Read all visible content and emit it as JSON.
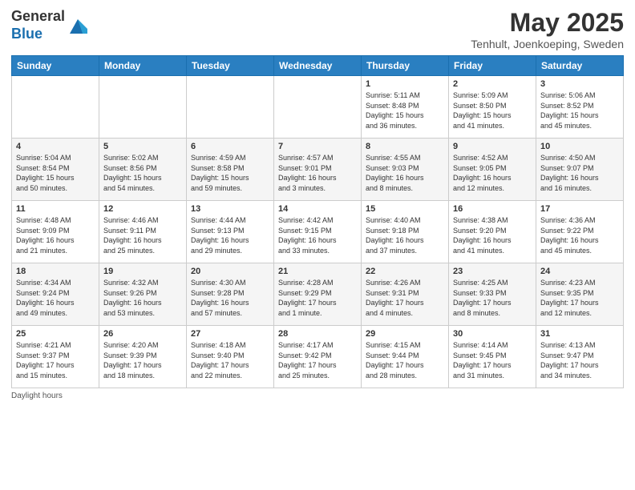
{
  "logo": {
    "line1": "General",
    "line2": "Blue"
  },
  "title": "May 2025",
  "subtitle": "Tenhult, Joenkoeping, Sweden",
  "footer": "Daylight hours",
  "weekdays": [
    "Sunday",
    "Monday",
    "Tuesday",
    "Wednesday",
    "Thursday",
    "Friday",
    "Saturday"
  ],
  "weeks": [
    [
      {
        "num": "",
        "info": ""
      },
      {
        "num": "",
        "info": ""
      },
      {
        "num": "",
        "info": ""
      },
      {
        "num": "",
        "info": ""
      },
      {
        "num": "1",
        "info": "Sunrise: 5:11 AM\nSunset: 8:48 PM\nDaylight: 15 hours\nand 36 minutes."
      },
      {
        "num": "2",
        "info": "Sunrise: 5:09 AM\nSunset: 8:50 PM\nDaylight: 15 hours\nand 41 minutes."
      },
      {
        "num": "3",
        "info": "Sunrise: 5:06 AM\nSunset: 8:52 PM\nDaylight: 15 hours\nand 45 minutes."
      }
    ],
    [
      {
        "num": "4",
        "info": "Sunrise: 5:04 AM\nSunset: 8:54 PM\nDaylight: 15 hours\nand 50 minutes."
      },
      {
        "num": "5",
        "info": "Sunrise: 5:02 AM\nSunset: 8:56 PM\nDaylight: 15 hours\nand 54 minutes."
      },
      {
        "num": "6",
        "info": "Sunrise: 4:59 AM\nSunset: 8:58 PM\nDaylight: 15 hours\nand 59 minutes."
      },
      {
        "num": "7",
        "info": "Sunrise: 4:57 AM\nSunset: 9:01 PM\nDaylight: 16 hours\nand 3 minutes."
      },
      {
        "num": "8",
        "info": "Sunrise: 4:55 AM\nSunset: 9:03 PM\nDaylight: 16 hours\nand 8 minutes."
      },
      {
        "num": "9",
        "info": "Sunrise: 4:52 AM\nSunset: 9:05 PM\nDaylight: 16 hours\nand 12 minutes."
      },
      {
        "num": "10",
        "info": "Sunrise: 4:50 AM\nSunset: 9:07 PM\nDaylight: 16 hours\nand 16 minutes."
      }
    ],
    [
      {
        "num": "11",
        "info": "Sunrise: 4:48 AM\nSunset: 9:09 PM\nDaylight: 16 hours\nand 21 minutes."
      },
      {
        "num": "12",
        "info": "Sunrise: 4:46 AM\nSunset: 9:11 PM\nDaylight: 16 hours\nand 25 minutes."
      },
      {
        "num": "13",
        "info": "Sunrise: 4:44 AM\nSunset: 9:13 PM\nDaylight: 16 hours\nand 29 minutes."
      },
      {
        "num": "14",
        "info": "Sunrise: 4:42 AM\nSunset: 9:15 PM\nDaylight: 16 hours\nand 33 minutes."
      },
      {
        "num": "15",
        "info": "Sunrise: 4:40 AM\nSunset: 9:18 PM\nDaylight: 16 hours\nand 37 minutes."
      },
      {
        "num": "16",
        "info": "Sunrise: 4:38 AM\nSunset: 9:20 PM\nDaylight: 16 hours\nand 41 minutes."
      },
      {
        "num": "17",
        "info": "Sunrise: 4:36 AM\nSunset: 9:22 PM\nDaylight: 16 hours\nand 45 minutes."
      }
    ],
    [
      {
        "num": "18",
        "info": "Sunrise: 4:34 AM\nSunset: 9:24 PM\nDaylight: 16 hours\nand 49 minutes."
      },
      {
        "num": "19",
        "info": "Sunrise: 4:32 AM\nSunset: 9:26 PM\nDaylight: 16 hours\nand 53 minutes."
      },
      {
        "num": "20",
        "info": "Sunrise: 4:30 AM\nSunset: 9:28 PM\nDaylight: 16 hours\nand 57 minutes."
      },
      {
        "num": "21",
        "info": "Sunrise: 4:28 AM\nSunset: 9:29 PM\nDaylight: 17 hours\nand 1 minute."
      },
      {
        "num": "22",
        "info": "Sunrise: 4:26 AM\nSunset: 9:31 PM\nDaylight: 17 hours\nand 4 minutes."
      },
      {
        "num": "23",
        "info": "Sunrise: 4:25 AM\nSunset: 9:33 PM\nDaylight: 17 hours\nand 8 minutes."
      },
      {
        "num": "24",
        "info": "Sunrise: 4:23 AM\nSunset: 9:35 PM\nDaylight: 17 hours\nand 12 minutes."
      }
    ],
    [
      {
        "num": "25",
        "info": "Sunrise: 4:21 AM\nSunset: 9:37 PM\nDaylight: 17 hours\nand 15 minutes."
      },
      {
        "num": "26",
        "info": "Sunrise: 4:20 AM\nSunset: 9:39 PM\nDaylight: 17 hours\nand 18 minutes."
      },
      {
        "num": "27",
        "info": "Sunrise: 4:18 AM\nSunset: 9:40 PM\nDaylight: 17 hours\nand 22 minutes."
      },
      {
        "num": "28",
        "info": "Sunrise: 4:17 AM\nSunset: 9:42 PM\nDaylight: 17 hours\nand 25 minutes."
      },
      {
        "num": "29",
        "info": "Sunrise: 4:15 AM\nSunset: 9:44 PM\nDaylight: 17 hours\nand 28 minutes."
      },
      {
        "num": "30",
        "info": "Sunrise: 4:14 AM\nSunset: 9:45 PM\nDaylight: 17 hours\nand 31 minutes."
      },
      {
        "num": "31",
        "info": "Sunrise: 4:13 AM\nSunset: 9:47 PM\nDaylight: 17 hours\nand 34 minutes."
      }
    ]
  ]
}
